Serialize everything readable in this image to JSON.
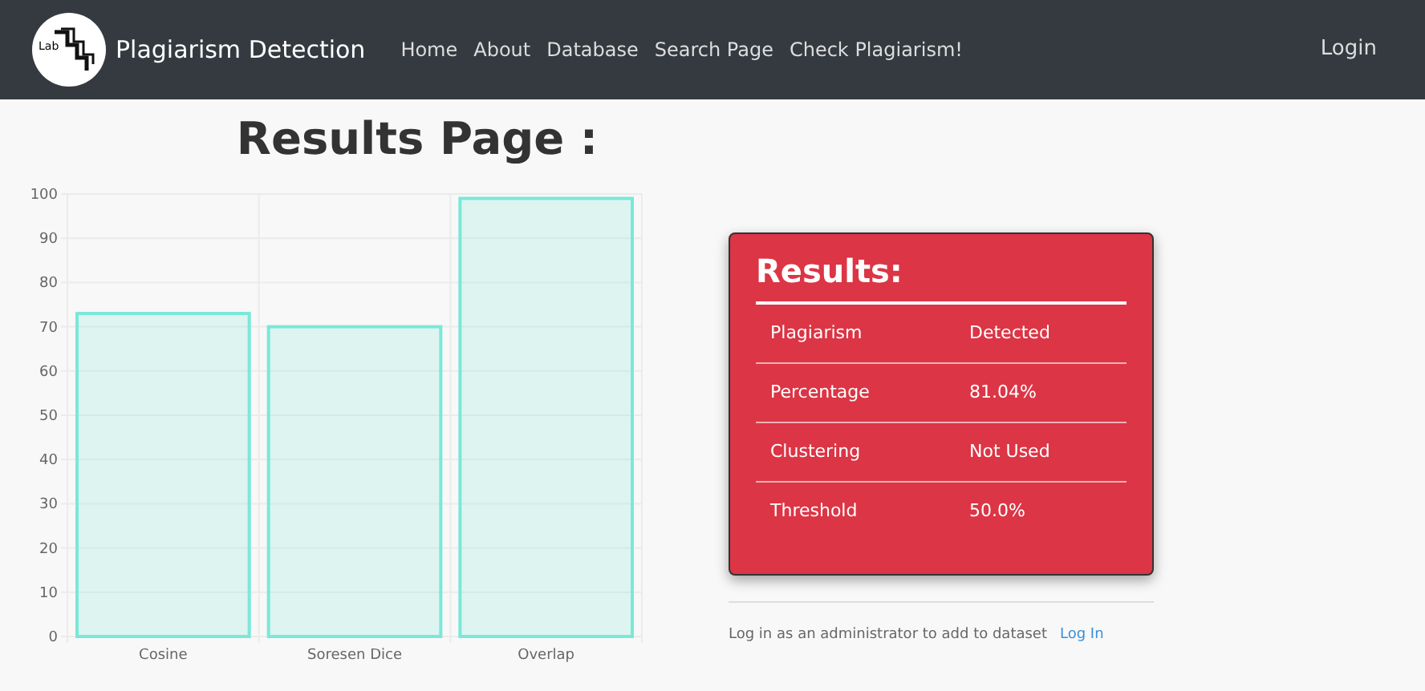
{
  "navbar": {
    "logo_text": "Lab",
    "brand": "Plagiarism Detection",
    "links": [
      "Home",
      "About",
      "Database",
      "Search Page",
      "Check Plagiarism!"
    ],
    "login": "Login"
  },
  "heading": "Results Page :",
  "chart": {
    "chart_data": {
      "type": "bar",
      "categories": [
        "Cosine",
        "Soresen Dice",
        "Overlap"
      ],
      "series": [
        {
          "color": "#7ae8d8",
          "values": [
            73,
            70,
            99
          ]
        }
      ],
      "grid": true,
      "ylim": [
        0,
        100
      ],
      "yticks": [
        0,
        10,
        20,
        30,
        40,
        50,
        60,
        70,
        80,
        90,
        100
      ]
    }
  },
  "results": {
    "title": "Results:",
    "rows": [
      {
        "label": "Plagiarism",
        "value": "Detected"
      },
      {
        "label": "Percentage",
        "value": "81.04%"
      },
      {
        "label": "Clustering",
        "value": "Not Used"
      },
      {
        "label": "Threshold",
        "value": "50.0%"
      }
    ]
  },
  "admin_note": {
    "text": "Log in as an administrator to add to dataset",
    "link": "Log In"
  }
}
